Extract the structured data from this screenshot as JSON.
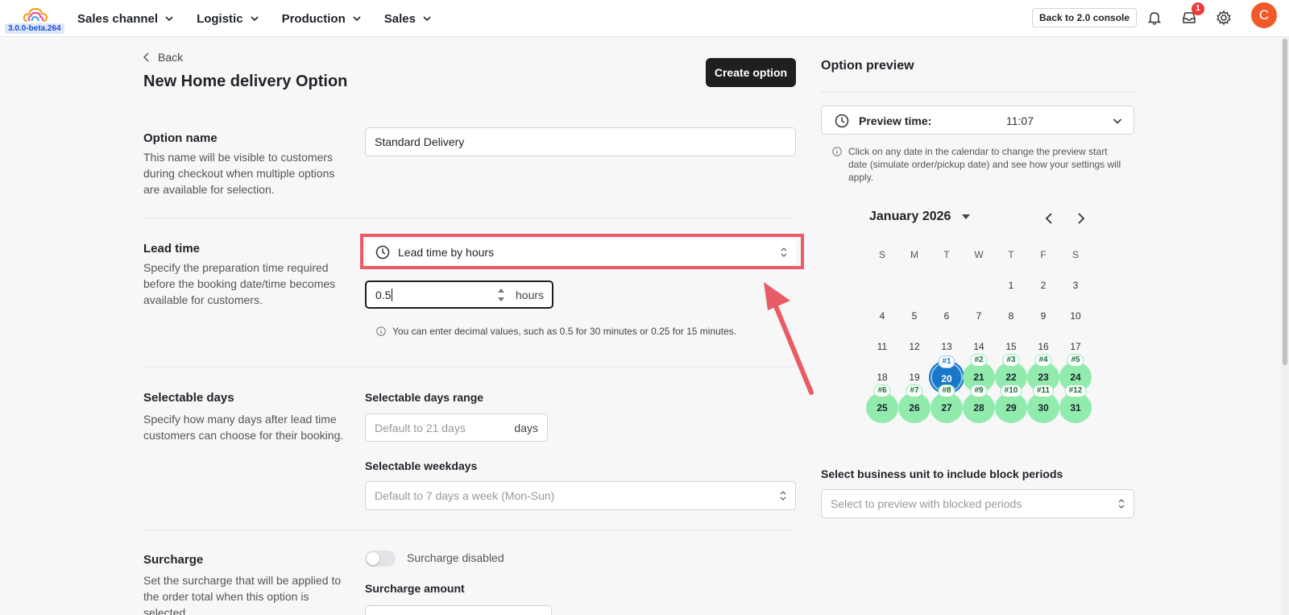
{
  "header": {
    "version": "3.0.0-beta.264",
    "nav": [
      "Sales channel",
      "Logistic",
      "Production",
      "Sales"
    ],
    "console_label": "Back to 2.0 console",
    "notification_count": "1",
    "avatar_initial": "C"
  },
  "page": {
    "back_label": "Back",
    "title": "New Home delivery Option",
    "create_label": "Create option"
  },
  "option_name": {
    "title": "Option name",
    "desc": "This name will be visible to customers during checkout when multiple options are available for selection.",
    "value": "Standard Delivery"
  },
  "lead_time": {
    "title": "Lead time",
    "desc": "Specify the preparation time required before the booking date/time becomes available for customers.",
    "mode": "Lead time by hours",
    "value": "0.5",
    "unit": "hours",
    "hint": "You can enter decimal values, such as 0.5 for 30 minutes or 0.25 for 15 minutes."
  },
  "selectable_days": {
    "title": "Selectable days",
    "desc": "Specify how many days after lead time customers can choose for their booking.",
    "range_label": "Selectable days range",
    "range_placeholder": "Default to 21 days",
    "range_unit": "days",
    "weekdays_label": "Selectable weekdays",
    "weekdays_placeholder": "Default to 7 days a week (Mon-Sun)"
  },
  "surcharge": {
    "title": "Surcharge",
    "desc": "Set the surcharge that will be applied to the order total when this option is selected.",
    "toggle_label": "Surcharge disabled",
    "amount_label": "Surcharge amount"
  },
  "preview": {
    "title": "Option preview",
    "time_label": "Preview time:",
    "time_value": "11:07",
    "note": "Click on any date in the calendar to change the preview start date (simulate order/pickup date) and see how your settings will apply.",
    "month": "January 2026",
    "weekdays": [
      "S",
      "M",
      "T",
      "W",
      "T",
      "F",
      "S"
    ],
    "bu_label": "Select business unit to include block periods",
    "bu_placeholder": "Select to preview with blocked periods"
  }
}
